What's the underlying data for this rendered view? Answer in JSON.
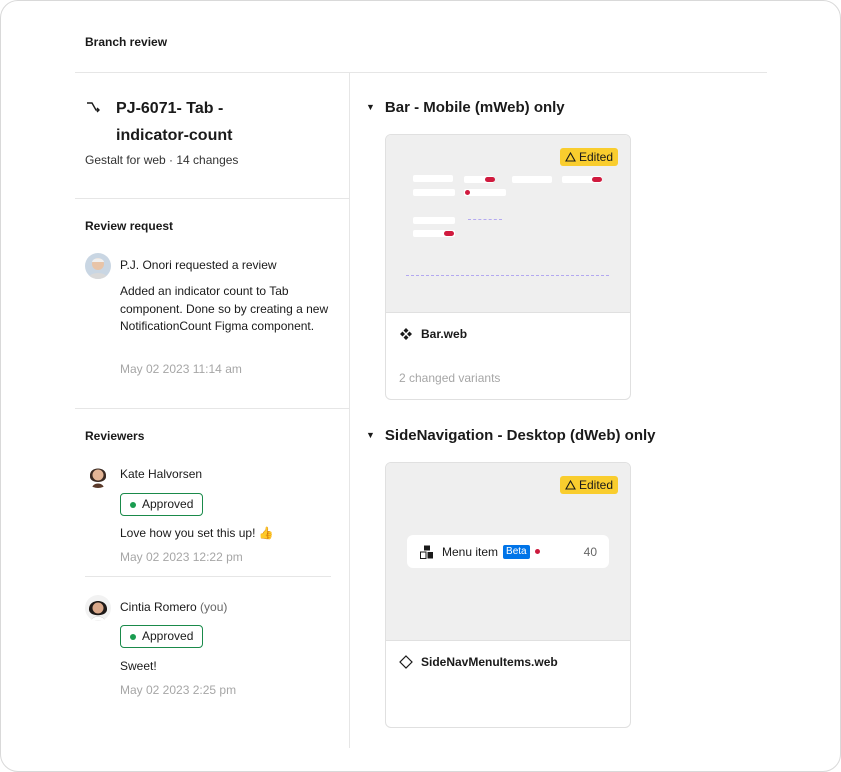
{
  "header": {
    "title": "Branch review"
  },
  "branch": {
    "title": "PJ-6071- Tab - indicator-count",
    "subtitle": "Gestalt for web · 14 changes"
  },
  "review_request": {
    "title": "Review request",
    "requester": "P.J. Onori requested a review",
    "message": "Added an indicator count to Tab component. Done so by creating a new NotificationCount Figma component.",
    "timestamp": "May 02 2023 11:14 am"
  },
  "reviewers": {
    "title": "Reviewers",
    "items": [
      {
        "name": "Kate Halvorsen",
        "you": "",
        "status": "Approved",
        "comment": "Love how you set this up! 👍",
        "timestamp": "May 02 2023 12:22 pm"
      },
      {
        "name": "Cintia Romero",
        "you": "(you)",
        "status": "Approved",
        "comment": "Sweet!",
        "timestamp": "May 02 2023 2:25 pm"
      }
    ]
  },
  "sections": [
    {
      "title": "Bar - Mobile (mWeb) only",
      "badge": "Edited",
      "component": "Bar.web",
      "meta": "2 changed variants"
    },
    {
      "title": "SideNavigation - Desktop (dWeb) only",
      "badge": "Edited",
      "component": "SideNavMenuItems.web",
      "preview": {
        "label": "Menu item",
        "beta": "Beta",
        "count": "40"
      }
    }
  ],
  "colors": {
    "approved": "#1a8a4a",
    "edited_badge": "#f9cd2e",
    "beta": "#0074e8",
    "notification": "#cc1a3d"
  }
}
